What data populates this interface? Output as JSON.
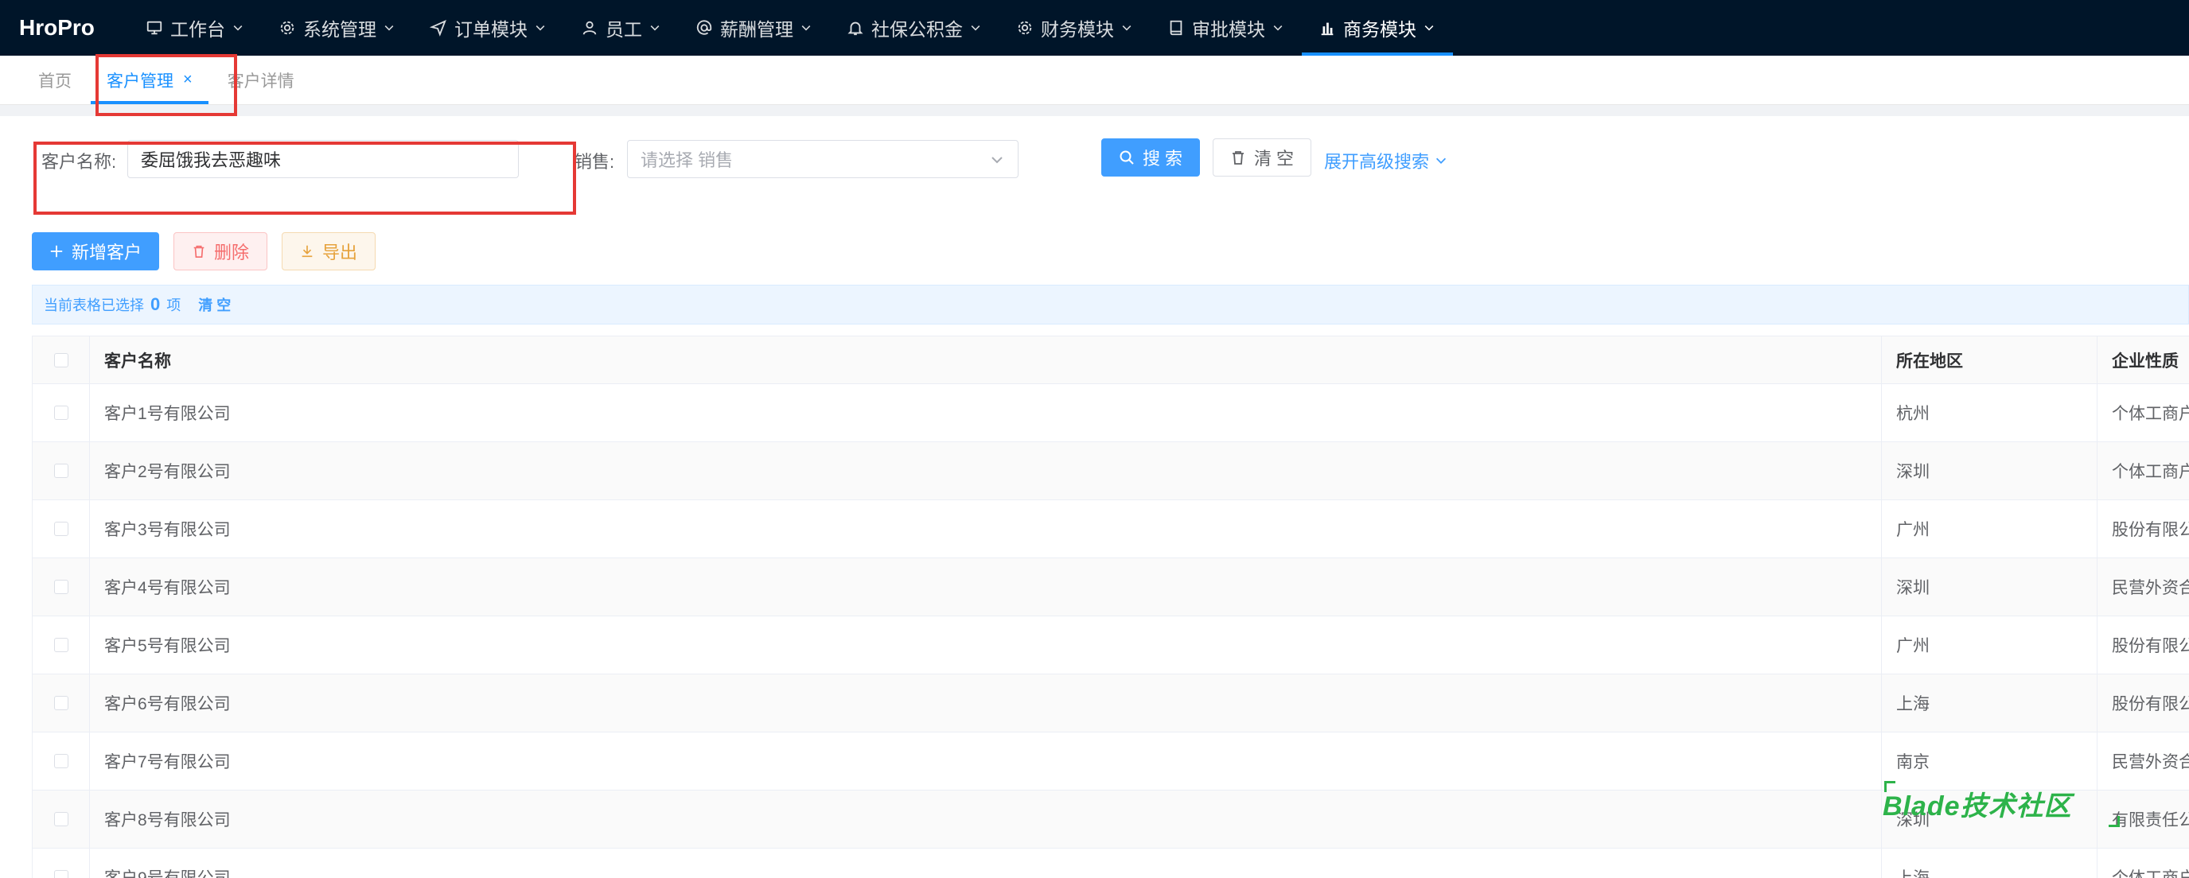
{
  "app": {
    "logo": "HroPro"
  },
  "nav": {
    "items": [
      {
        "label": "工作台",
        "icon": "monitor-icon"
      },
      {
        "label": "系统管理",
        "icon": "gear-icon"
      },
      {
        "label": "订单模块",
        "icon": "send-icon"
      },
      {
        "label": "员工",
        "icon": "user-icon"
      },
      {
        "label": "薪酬管理",
        "icon": "at-icon"
      },
      {
        "label": "社保公积金",
        "icon": "bell-icon"
      },
      {
        "label": "财务模块",
        "icon": "gear-icon"
      },
      {
        "label": "审批模块",
        "icon": "book-icon"
      },
      {
        "label": "商务模块",
        "icon": "bar-chart-icon"
      }
    ],
    "active_index": 8
  },
  "tabs": [
    {
      "label": "首页"
    },
    {
      "label": "客户管理",
      "close": "×"
    },
    {
      "label": "客户详情"
    }
  ],
  "search": {
    "customer_name_label": "客户名称:",
    "customer_name_value": "委屈饿我去恶趣味",
    "sales_label": "销售:",
    "sales_placeholder": "请选择 销售",
    "search_button": "搜 索",
    "clear_button": "清 空",
    "advanced_link": "展开高级搜索"
  },
  "toolbar": {
    "add_button": "新增客户",
    "delete_button": "删除",
    "export_button": "导出"
  },
  "selection": {
    "prefix": "当前表格已选择",
    "count": "0",
    "suffix": "项",
    "clear": "清 空"
  },
  "table": {
    "columns": [
      "客户名称",
      "所在地区",
      "企业性质"
    ],
    "rows": [
      {
        "name": "客户1号有限公司",
        "region": "杭州",
        "nature": "个体工商户"
      },
      {
        "name": "客户2号有限公司",
        "region": "深圳",
        "nature": "个体工商户"
      },
      {
        "name": "客户3号有限公司",
        "region": "广州",
        "nature": "股份有限公司"
      },
      {
        "name": "客户4号有限公司",
        "region": "深圳",
        "nature": "民营外资合"
      },
      {
        "name": "客户5号有限公司",
        "region": "广州",
        "nature": "股份有限公司"
      },
      {
        "name": "客户6号有限公司",
        "region": "上海",
        "nature": "股份有限公司"
      },
      {
        "name": "客户7号有限公司",
        "region": "南京",
        "nature": "民营外资合"
      },
      {
        "name": "客户8号有限公司",
        "region": "深圳",
        "nature": "有限责任公"
      },
      {
        "name": "客户9号有限公司",
        "region": "上海",
        "nature": "个体工商户"
      }
    ]
  },
  "watermark": {
    "text": "Blade技术社区"
  },
  "colors": {
    "nav_bg": "#001529",
    "primary": "#409eff",
    "highlight": "#e53935"
  }
}
